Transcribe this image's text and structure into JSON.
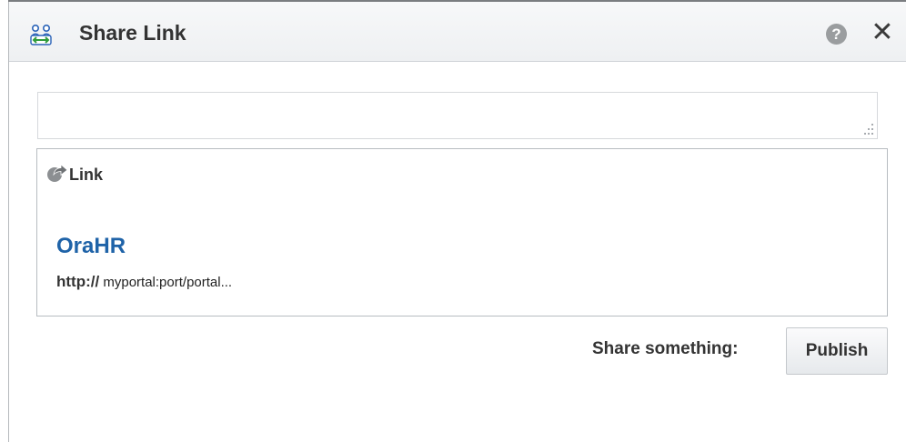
{
  "dialog": {
    "title": "Share Link",
    "title_icon": "share-people-icon",
    "help_label": "?",
    "close_label": "✕"
  },
  "comment": {
    "value": "",
    "placeholder": ""
  },
  "link": {
    "type_icon": "share-arrow-icon",
    "type_label": "Link",
    "title": "OraHR",
    "url_protocol": "http://",
    "url_path": " myportal:port/portal..."
  },
  "actions": {
    "share_label": "Share something:",
    "publish_label": "Publish"
  },
  "colors": {
    "link_title": "#1f63a8",
    "header_bg": "#f2f4f5",
    "border": "#b7bcc1"
  }
}
